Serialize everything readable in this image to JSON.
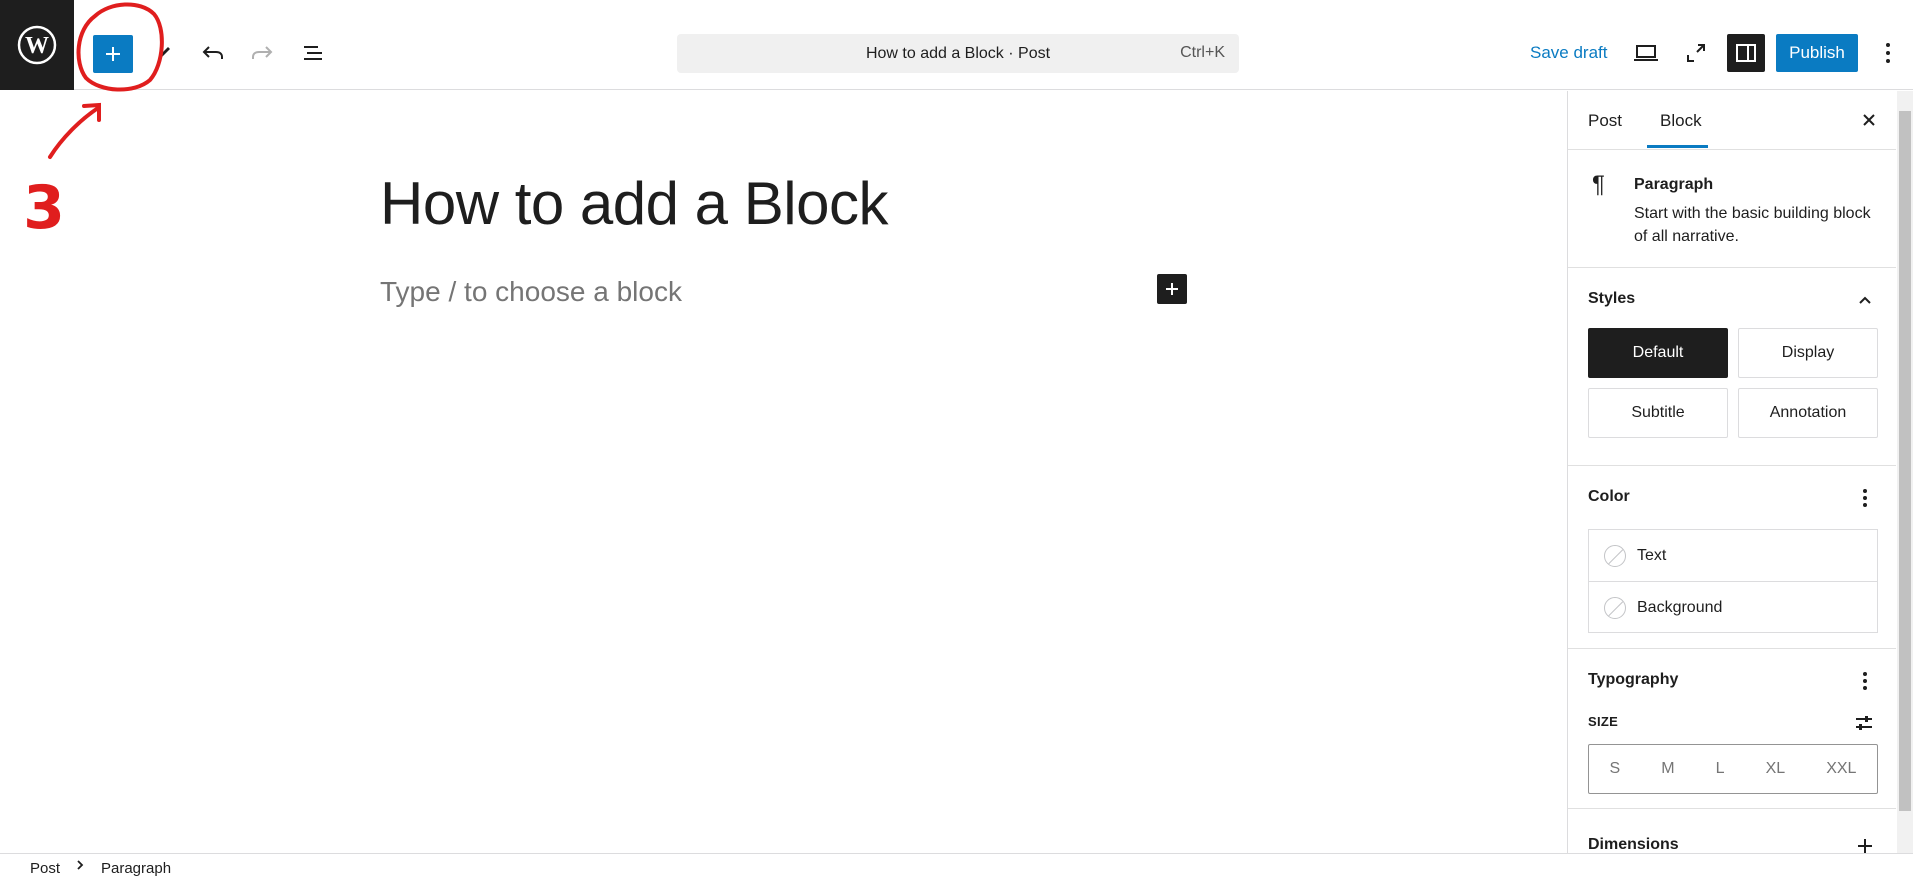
{
  "topbar": {
    "command_text": "How to add a Block · Post",
    "command_shortcut": "Ctrl+K",
    "save_draft": "Save draft",
    "publish": "Publish"
  },
  "editor": {
    "title": "How to add a Block",
    "paragraph_placeholder": "Type / to choose a block"
  },
  "annotation": {
    "step_number": "3"
  },
  "sidebar": {
    "tabs": [
      "Post",
      "Block"
    ],
    "active_tab": "Block",
    "block": {
      "name": "Paragraph",
      "description": "Start with the basic building block of all narrative."
    },
    "styles": {
      "title": "Styles",
      "options": [
        "Default",
        "Display",
        "Subtitle",
        "Annotation"
      ],
      "selected": "Default"
    },
    "color": {
      "title": "Color",
      "items": [
        "Text",
        "Background"
      ]
    },
    "typography": {
      "title": "Typography",
      "size_label": "SIZE",
      "sizes": [
        "S",
        "M",
        "L",
        "XL",
        "XXL"
      ]
    },
    "dimensions": {
      "title": "Dimensions"
    }
  },
  "footer": {
    "breadcrumb": [
      "Post",
      "Paragraph"
    ]
  },
  "colors": {
    "accent": "#0a7bc2",
    "dark": "#1e1e1e",
    "annotation_red": "#e01e1e"
  }
}
